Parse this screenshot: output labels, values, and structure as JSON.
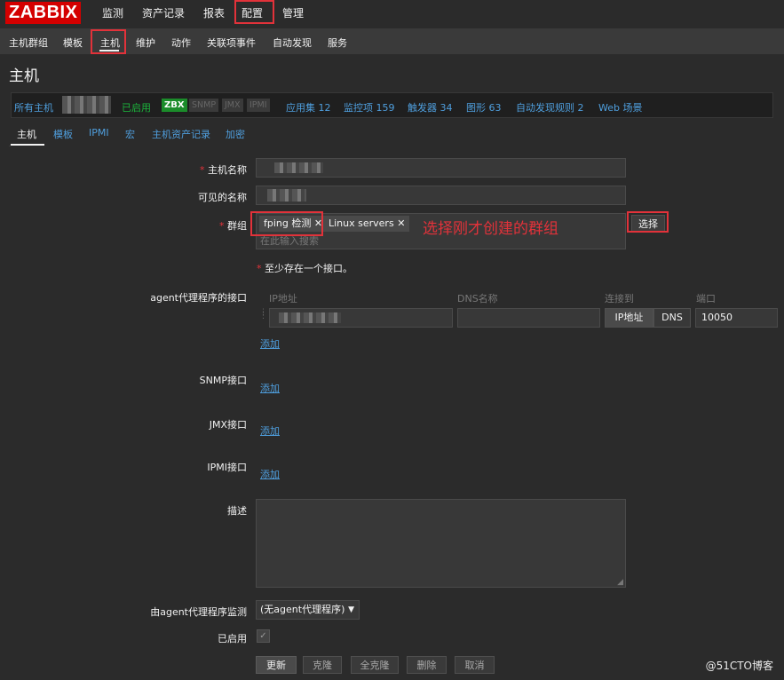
{
  "app": {
    "logo": "ZABBIX"
  },
  "topnav": [
    "监测",
    "资产记录",
    "报表",
    "配置",
    "管理"
  ],
  "subnav": [
    "主机群组",
    "模板",
    "主机",
    "维护",
    "动作",
    "关联项事件",
    "自动发现",
    "服务"
  ],
  "page": {
    "title": "主机"
  },
  "hostbar": {
    "all_hosts": "所有主机",
    "enabled": "已启用",
    "zbx": "ZBX",
    "snmp": "SNMP",
    "jmx": "JMX",
    "ipmi": "IPMI",
    "apps": "应用集 12",
    "items": "监控项 159",
    "triggers": "触发器 34",
    "graphs": "图形 63",
    "discovery": "自动发现规则 2",
    "web": "Web 场景"
  },
  "formtabs": [
    "主机",
    "模板",
    "IPMI",
    "宏",
    "主机资产记录",
    "加密"
  ],
  "form": {
    "hostname_label": "主机名称",
    "visible_name_label": "可见的名称",
    "groups_label": "群组",
    "groups": [
      "fping 检测",
      "Linux servers"
    ],
    "groups_placeholder": "在此输入搜索",
    "select_button": "选择",
    "annotation": "选择刚才创建的群组",
    "interface_required": "至少存在一个接口。",
    "agent_interface_label": "agent代理程序的接口",
    "col_ip": "IP地址",
    "col_dns": "DNS名称",
    "col_connect": "连接到",
    "col_port": "端口",
    "connect_ip": "IP地址",
    "connect_dns": "DNS",
    "port_value": "10050",
    "add": "添加",
    "snmp_label": "SNMP接口",
    "jmx_label": "JMX接口",
    "ipmi_label": "IPMI接口",
    "description_label": "描述",
    "proxy_label": "由agent代理程序监测",
    "proxy_value": "(无agent代理程序)",
    "enabled_label": "已启用",
    "buttons": {
      "update": "更新",
      "clone": "克隆",
      "full_clone": "全克隆",
      "delete": "删除",
      "cancel": "取消"
    }
  },
  "watermark": "@51CTO博客",
  "colors": {
    "accent_red": "#e2323a",
    "link_blue": "#4f9fde",
    "zbx_green": "#1b8c2a",
    "logo_red": "#d40000"
  }
}
